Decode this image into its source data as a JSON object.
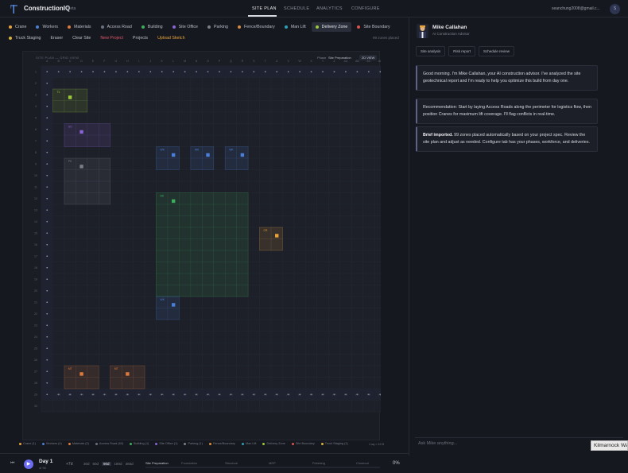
{
  "app": {
    "name": "ConstructionIQ",
    "badge": "Beta",
    "logo_icon": "crane-logo-icon"
  },
  "nav": {
    "tabs": [
      {
        "label": "SITE PLAN",
        "active": true
      },
      {
        "label": "SCHEDULE"
      },
      {
        "label": "ANALYTICS"
      },
      {
        "label": "CONFIGURE"
      }
    ]
  },
  "user": {
    "email": "seanchung2008@gmail.c...",
    "avatar": "S"
  },
  "tools": {
    "row1": [
      {
        "label": "Crane",
        "color": "#e8a23a"
      },
      {
        "label": "Workers",
        "color": "#4a7fd8"
      },
      {
        "label": "Materials",
        "color": "#e07a3c"
      },
      {
        "label": "Access Road",
        "color": "#6b7280"
      },
      {
        "label": "Building",
        "color": "#3fae5c"
      },
      {
        "label": "Site Office",
        "color": "#8a63d6"
      },
      {
        "label": "Parking",
        "color": "#7a7f8a"
      },
      {
        "label": "Fence/Boundary",
        "color": "#d98b3a"
      },
      {
        "label": "Man Lift",
        "color": "#2f9fb3"
      },
      {
        "label": "Delivery Zone",
        "color": "#9bc93a",
        "selected": true
      },
      {
        "label": "Site Boundary",
        "color": "#d9534f"
      }
    ],
    "row2": [
      {
        "label": "Truck Staging",
        "color": "#d9b23a"
      }
    ],
    "actions": [
      {
        "label": "Eraser",
        "color": "#b9bdc7"
      },
      {
        "label": "Clear Site",
        "color": "#b9bdc7"
      },
      {
        "label": "New Project",
        "color": "#e0556a"
      },
      {
        "label": "Projects",
        "color": "#b9bdc7"
      },
      {
        "label": "Upload Sketch",
        "color": "#e8a23a"
      }
    ],
    "zones_placed": "99 zones placed"
  },
  "canvas": {
    "title": "SITE PLAN — GRID VIEW",
    "phase_label": "Phase",
    "phase_value": "Site Preparation",
    "view_button": "2D VIEW",
    "col_labels": [
      "A",
      "B",
      "C",
      "D",
      "E",
      "F",
      "G",
      "H",
      "I",
      "J",
      "K",
      "L",
      "M",
      "N",
      "O",
      "P",
      "Q",
      "R",
      "S",
      "T",
      "U",
      "V",
      "W",
      "X",
      "Y",
      "Z",
      "AA",
      "AB",
      "AC",
      "AD"
    ],
    "row_labels": [
      "1",
      "2",
      "3",
      "4",
      "5",
      "6",
      "7",
      "8",
      "9",
      "10",
      "11",
      "12",
      "13",
      "14",
      "15",
      "16",
      "17",
      "18",
      "19",
      "20",
      "21",
      "22",
      "23",
      "24",
      "25",
      "26",
      "27",
      "28",
      "29",
      "30"
    ],
    "zones": [
      {
        "tag": "T1",
        "color": "#9bc93a",
        "c0": 1,
        "r0": 2,
        "c1": 3,
        "r1": 3
      },
      {
        "tag": "SO",
        "color": "#8a63d6",
        "c0": 2,
        "r0": 5,
        "c1": 5,
        "r1": 6
      },
      {
        "tag": "PK",
        "color": "#7a7f8a",
        "c0": 2,
        "r0": 8,
        "c1": 5,
        "r1": 11
      },
      {
        "tag": "WK",
        "color": "#4a7fd8",
        "c0": 10,
        "r0": 7,
        "c1": 11,
        "r1": 8
      },
      {
        "tag": "WK",
        "color": "#4a7fd8",
        "c0": 13,
        "r0": 7,
        "c1": 14,
        "r1": 8
      },
      {
        "tag": "WK",
        "color": "#4a7fd8",
        "c0": 16,
        "r0": 7,
        "c1": 17,
        "r1": 8
      },
      {
        "tag": "BD",
        "color": "#3fae5c",
        "c0": 10,
        "r0": 11,
        "c1": 17,
        "r1": 19
      },
      {
        "tag": "CR",
        "color": "#e8a23a",
        "c0": 19,
        "r0": 14,
        "c1": 20,
        "r1": 15
      },
      {
        "tag": "WK",
        "color": "#4a7fd8",
        "c0": 10,
        "r0": 20,
        "c1": 11,
        "r1": 21
      },
      {
        "tag": "MT",
        "color": "#e07a3c",
        "c0": 2,
        "r0": 26,
        "c1": 4,
        "r1": 27
      },
      {
        "tag": "MT",
        "color": "#e07a3c",
        "c0": 6,
        "r0": 26,
        "c1": 8,
        "r1": 27
      }
    ],
    "road_label": "AR"
  },
  "legend": {
    "items": [
      {
        "label": "Crane (1)",
        "color": "#e8a23a"
      },
      {
        "label": "Workers (4)",
        "color": "#4a7fd8"
      },
      {
        "label": "Materials (2)",
        "color": "#e07a3c"
      },
      {
        "label": "Access Road (60)",
        "color": "#6b7280"
      },
      {
        "label": "Building (1)",
        "color": "#3fae5c"
      },
      {
        "label": "Site Office (1)",
        "color": "#8a63d6"
      },
      {
        "label": "Parking (1)",
        "color": "#7a7f8a"
      },
      {
        "label": "Fence/Boundary",
        "color": "#d98b3a"
      },
      {
        "label": "Man Lift",
        "color": "#2f9fb3"
      },
      {
        "label": "Delivery Zone",
        "color": "#9bc93a"
      },
      {
        "label": "Site Boundary",
        "color": "#d9534f"
      },
      {
        "label": "Truck Staging (1)",
        "color": "#d9b23a"
      }
    ],
    "ratio": "1 sq = 10 ft"
  },
  "timeline": {
    "day": "Day 1",
    "date": "of 90",
    "step": "+7d",
    "speeds": [
      {
        "label": "30d"
      },
      {
        "label": "60d"
      },
      {
        "label": "90d",
        "on": true
      },
      {
        "label": "180d"
      },
      {
        "label": "365d"
      }
    ],
    "phases": [
      "Site Preparation",
      "Foundation",
      "Structure",
      "MEP",
      "Finishing",
      "Closeout"
    ],
    "percent": "0%",
    "progress_fraction": 0
  },
  "advisor": {
    "name": "Mike Callahan",
    "role": "AI Construction Advisor",
    "tabs": [
      "Site analysis",
      "Risk report",
      "Schedule review"
    ],
    "messages": [
      {
        "text": "Good morning. I'm Mike Callahan, your AI construction advisor. I've analyzed the site geotechnical report and I'm ready to help you optimize this build from day one."
      },
      {
        "text": "Recommendation: Start by laying Access Roads along the perimeter for logistics flow, then position Cranes for maximum lift coverage. I'll flag conflicts in real-time."
      },
      {
        "bold": "Brief imported.",
        "text": " 99 zones placed automatically based on your project spec. Review the site plan and adjust as needed. Configure tab has your phases, workforce, and deliveries."
      }
    ],
    "input_placeholder": "Ask Mike anything..."
  },
  "tooltip": "Kilmarnock Way"
}
